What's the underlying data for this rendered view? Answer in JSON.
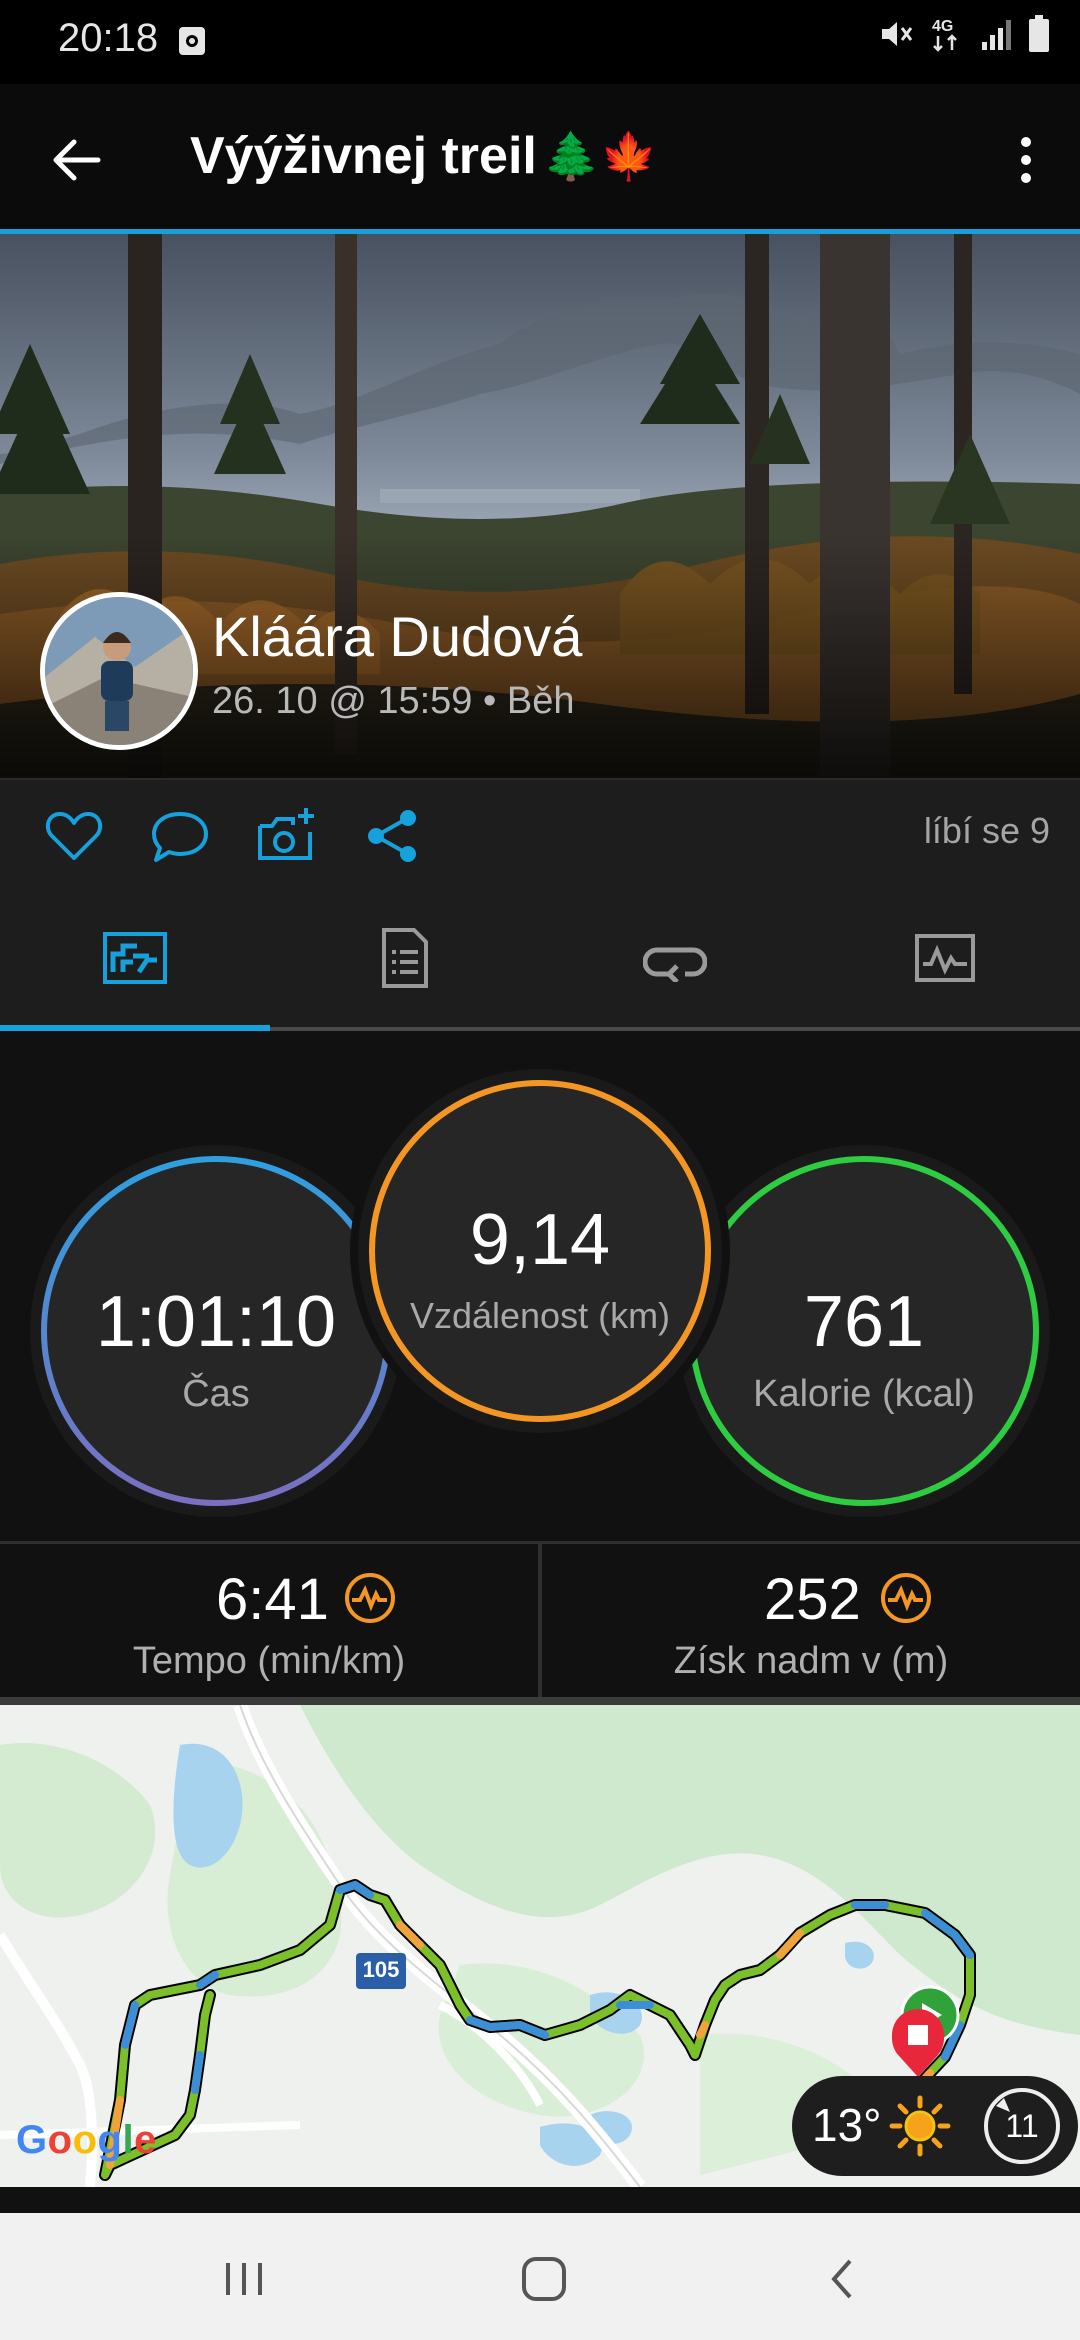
{
  "status_bar": {
    "time": "20:18"
  },
  "app_bar": {
    "title": "Výýživnej treil",
    "title_emoji": "🌲🍁"
  },
  "colors": {
    "accent": "#16a0dc",
    "time_ring": "#2f9fe0",
    "distance_ring": "#f39623",
    "calories_ring": "#2ecc40",
    "metric_icon": "#f39623"
  },
  "activity": {
    "user_name": "Kláára Dudová",
    "meta": "26. 10 @ 15:59 • Běh"
  },
  "actions": {
    "likes": "líbí se 9"
  },
  "tabs": [
    {
      "icon": "summary-icon",
      "selected": true
    },
    {
      "icon": "details-icon",
      "selected": false
    },
    {
      "icon": "laps-icon",
      "selected": false
    },
    {
      "icon": "charts-icon",
      "selected": false
    }
  ],
  "stats": {
    "time": {
      "value": "1:01:10",
      "label": "Čas"
    },
    "distance": {
      "value": "9,14",
      "label": "Vzdálenost (km)"
    },
    "calories": {
      "value": "761",
      "label": "Kalorie (kcal)"
    }
  },
  "metrics": {
    "pace": {
      "value": "6:41",
      "label": "Tempo (min/km)"
    },
    "elevation": {
      "value": "252",
      "label": "Získ nadm v (m)"
    }
  },
  "map": {
    "road_label": "105",
    "temperature": "13°",
    "wind": "11",
    "attribution": "Google"
  }
}
